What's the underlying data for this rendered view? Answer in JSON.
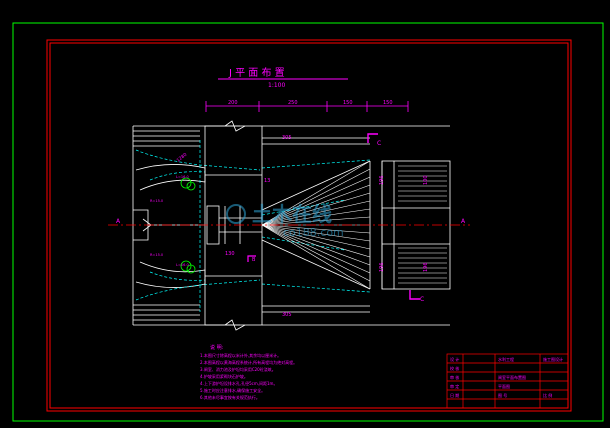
{
  "drawing": {
    "title": "J 平 面 布 置",
    "scale": "1:100",
    "dims_top": [
      "200",
      "250",
      "150",
      "150"
    ],
    "dim_left_a": "305",
    "dim_left_b": "305",
    "dim_center": "13",
    "dim_mid": "130",
    "dim_v1": "196",
    "dim_v2": "100",
    "dim_v3": "196",
    "dim_v4": "196",
    "dim_diag": "1280",
    "section_c_top": "C",
    "section_c_bottom": "C",
    "section_b": "B",
    "label_a_left": "A",
    "label_a_right": "A",
    "label_r1": "R=15.0",
    "label_r2": "R=15.0",
    "label_l1": "L=16.0",
    "label_l2": "L=16.0",
    "notes_title": "说    明:",
    "notes": [
      "1.本图尺寸除高程以米计外,其余均以厘米计。",
      "2.本图高程以黄海高程系统计,所有高程均为绝对高程。",
      "3.闸室、消力池及护坦均采用C20砼浇筑。",
      "   4.护坡采用浆砌块石护坡。",
      "4.上下游护坦设排水孔,孔径5cm,间距1m。",
      "5.施工时应注意排水,确保施工安全。",
      "6.其他未尽事宜按有关规范执行。"
    ],
    "watermark_brand": "土木在线",
    "watermark_url": "co188.com"
  },
  "title_block": {
    "r1": [
      "设 计",
      "",
      "水利工程",
      "施工图设计"
    ],
    "r2": [
      "校 核",
      ""
    ],
    "r3": [
      "审 核",
      "",
      "闸室平面布置图",
      ""
    ],
    "r4": [
      "审 定",
      "",
      "平面图",
      ""
    ],
    "r5": [
      "日 期",
      "",
      "图 号",
      "比 例"
    ],
    "r6": [
      "",
      "",
      "",
      ""
    ]
  },
  "colors": {
    "outer_frame": "#00ff00",
    "inner_frame": "#ff0000",
    "lines": "#ffffff",
    "dims": "#ff00ff",
    "hidden": "#00ffff",
    "plants": "#00ff00",
    "watermark": "#2ea6d8"
  }
}
